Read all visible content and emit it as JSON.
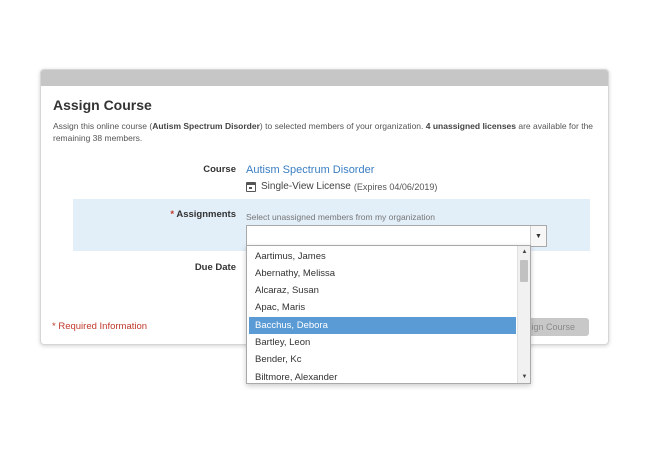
{
  "card": {
    "title": "Assign Course",
    "intro": {
      "part1": "Assign this online course (",
      "course_bold": "Autism Spectrum Disorder",
      "part2": ") to selected members of your organization. ",
      "licenses_bold": "4 unassigned licenses",
      "part3": " are available for the remaining 38 members."
    }
  },
  "course": {
    "label": "Course",
    "name": "Autism Spectrum Disorder",
    "license_type": "Single-View License",
    "expires": "(Expires 04/06/2019)"
  },
  "assignments": {
    "required_marker": "*",
    "label": "Assignments",
    "hint": "Select unassigned members from my organization",
    "value": ""
  },
  "due_date": {
    "label": "Due Date"
  },
  "footer": {
    "required_info": "* Required Information",
    "assign_button": "sign Course"
  },
  "dropdown": {
    "selected": "Bacchus, Debora",
    "options": [
      "Aartimus, James",
      "Abernathy, Melissa",
      "Alcaraz, Susan",
      "Apac, Maris",
      "Bacchus, Debora",
      "Bartley, Leon",
      "Bender, Kc",
      "Biltmore, Alexander"
    ]
  },
  "colors": {
    "accent_link": "#3a7ec2",
    "selection": "#5b9bd5",
    "required": "#c0392b",
    "assign_row_bg": "#e2eef8"
  }
}
